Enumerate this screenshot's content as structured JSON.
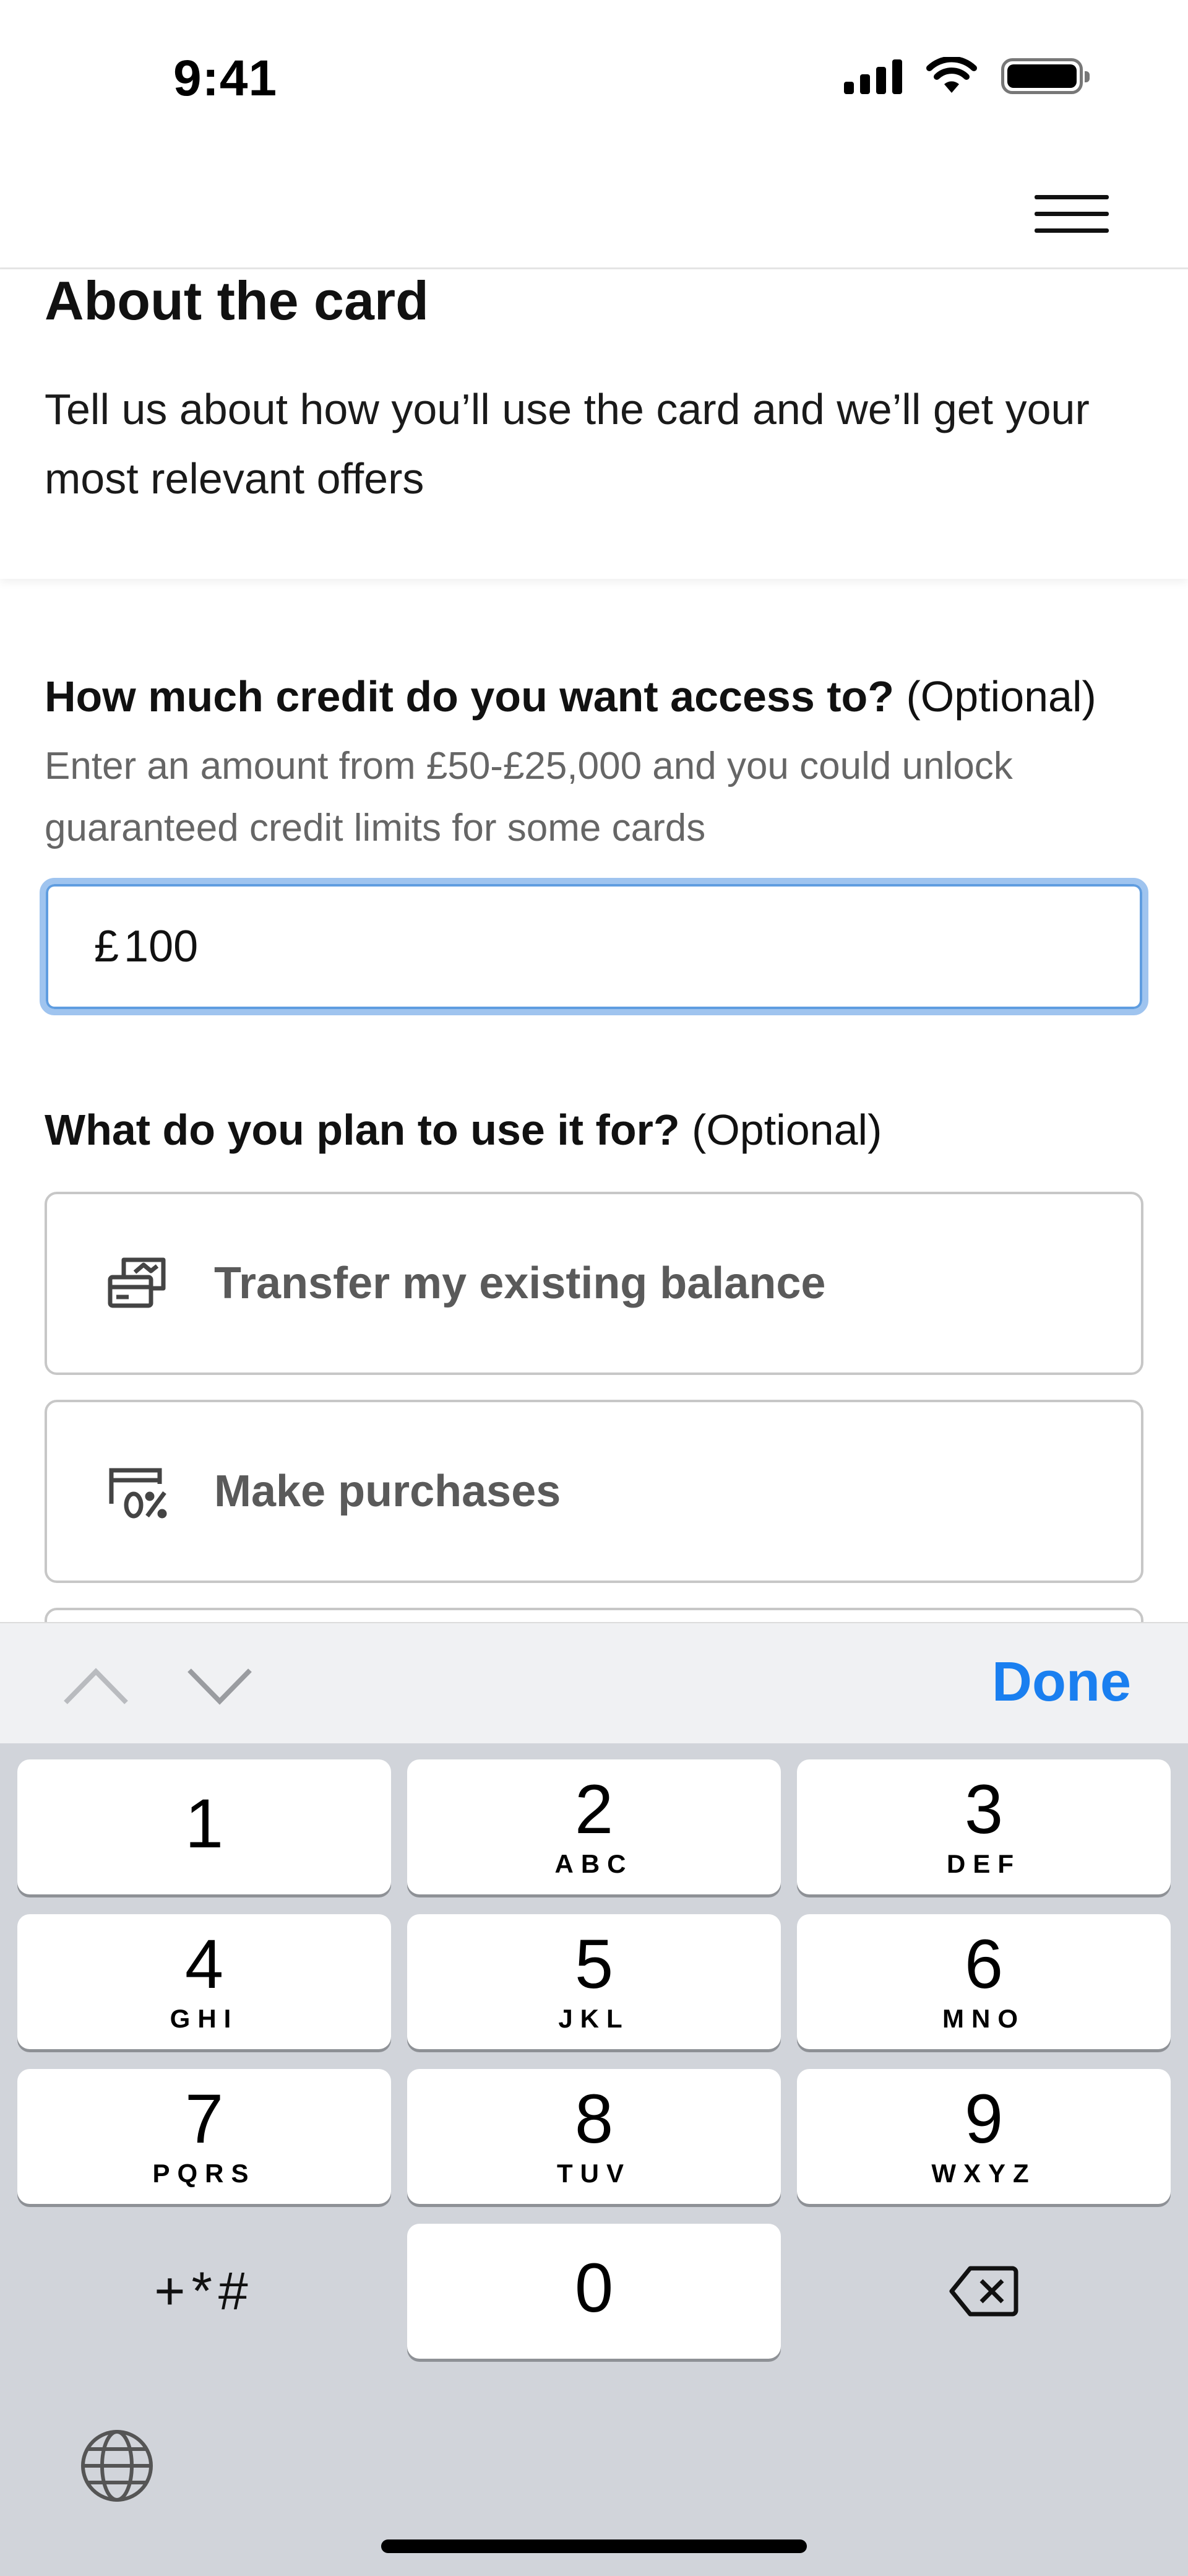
{
  "status_bar": {
    "time": "9:41"
  },
  "about": {
    "title": "About the card",
    "description": "Tell us about how you’ll use the card and we’ll get your most relevant offers"
  },
  "credit_question": {
    "title": "How much credit do you want access to?",
    "optional": "(Optional)",
    "hint": "Enter an amount from £50-£25,000 and you could unlock guaranteed credit limits for some cards",
    "currency": "£",
    "value": "100"
  },
  "usage_question": {
    "title": "What do you plan to use it for?",
    "optional": "(Optional)",
    "options": [
      {
        "label": "Transfer my existing balance",
        "icon": "balance-transfer-icon"
      },
      {
        "label": "Make purchases",
        "icon": "purchase-zero-percent-icon"
      }
    ]
  },
  "keyboard_toolbar": {
    "done_label": "Done"
  },
  "keyboard": {
    "keys": [
      {
        "digit": "1",
        "letters": ""
      },
      {
        "digit": "2",
        "letters": "ABC"
      },
      {
        "digit": "3",
        "letters": "DEF"
      },
      {
        "digit": "4",
        "letters": "GHI"
      },
      {
        "digit": "5",
        "letters": "JKL"
      },
      {
        "digit": "6",
        "letters": "MNO"
      },
      {
        "digit": "7",
        "letters": "PQRS"
      },
      {
        "digit": "8",
        "letters": "TUV"
      },
      {
        "digit": "9",
        "letters": "WXYZ"
      },
      {
        "digit": "0",
        "letters": ""
      }
    ],
    "symbols_label": "+*#"
  },
  "colors": {
    "accent": "#1a7ff0",
    "input_focus_border": "#9fc4ef",
    "keyboard_bg": "#d1d4da",
    "toolbar_bg": "#f0f1f3"
  }
}
